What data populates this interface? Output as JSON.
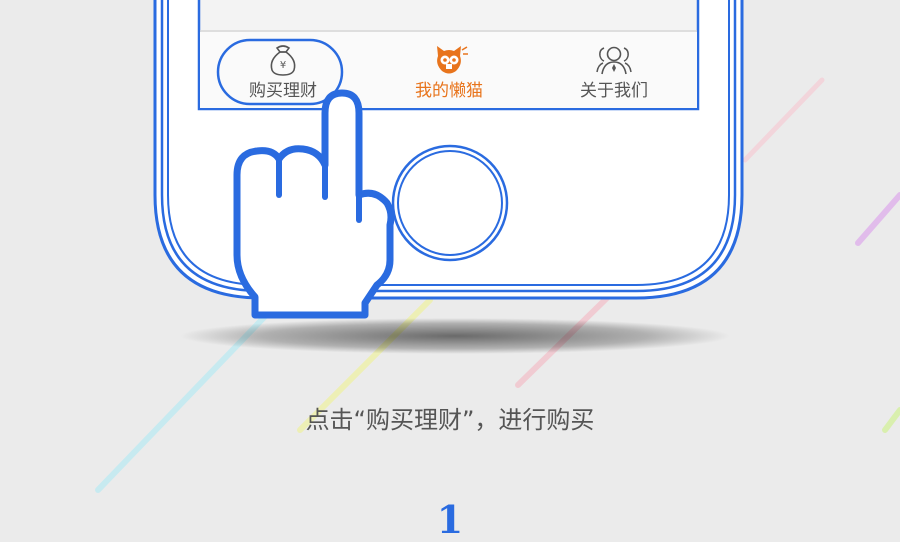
{
  "tabbar": {
    "tabs": [
      {
        "label": "购买理财",
        "icon": "money-bag-icon",
        "active": false,
        "highlighted": true
      },
      {
        "label": "我的懒猫",
        "icon": "cat-icon",
        "active": true,
        "highlighted": false
      },
      {
        "label": "关于我们",
        "icon": "users-icon",
        "active": false,
        "highlighted": false
      }
    ]
  },
  "caption": "点击“购买理财”，进行购买",
  "step_number": "1",
  "colors": {
    "phone_outline": "#2a6be0",
    "active_tab": "#e8741c",
    "background": "#ebebeb"
  }
}
